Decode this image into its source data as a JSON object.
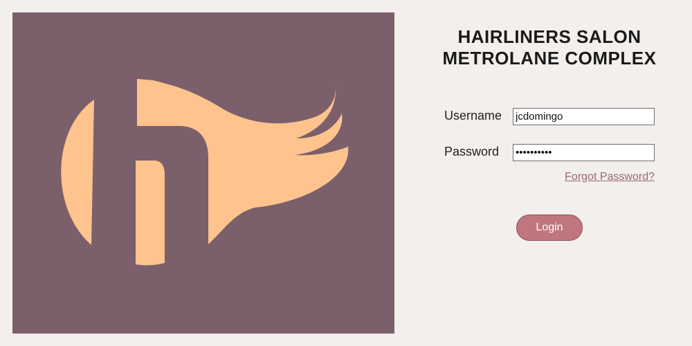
{
  "brand": {
    "logo_icon": "hairliners-logo-icon",
    "panel_color": "#7b5f6b",
    "logo_color": "#ffc38e"
  },
  "header": {
    "title_line1": "HAIRLINERS SALON",
    "title_line2": "METROLANE COMPLEX"
  },
  "login_form": {
    "username_label": "Username",
    "username_value": "jcdomingo",
    "password_label": "Password",
    "password_value": "••••••••••",
    "forgot_password_label": "Forgot Password?",
    "login_button_label": "Login",
    "accent_color": "#c0767e",
    "link_color": "#9a6479"
  }
}
